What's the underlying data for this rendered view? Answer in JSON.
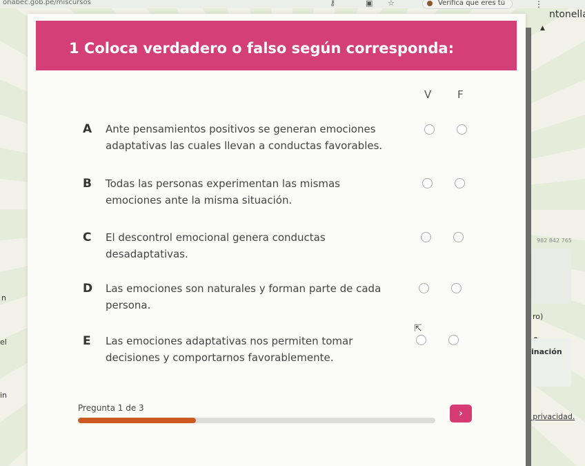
{
  "browser": {
    "url": "onabec.gob.pe/miscursos",
    "verify_chip": "Verifica que eres tú",
    "kebab": "⋮"
  },
  "side_fragments": {
    "right_top": "ntonella,",
    "right_phone": "982 842 765",
    "right_ro": "ro)",
    "right_o": "o",
    "right_inacion": "inación",
    "right_privacy": "e privacidad.",
    "left_n": "n",
    "left_el": "el",
    "left_in": "in"
  },
  "quiz": {
    "title": "1  Coloca verdadero o falso según corresponda:",
    "col_v": "V",
    "col_f": "F",
    "items": [
      {
        "letter": "A",
        "text": "Ante pensamientos positivos se generan emociones adaptativas las cuales llevan a conductas favorables."
      },
      {
        "letter": "B",
        "text": "Todas las personas experimentan las mismas emociones ante la misma situación."
      },
      {
        "letter": "C",
        "text": "El descontrol emocional genera conductas desadaptativas."
      },
      {
        "letter": "D",
        "text": "Las emociones son naturales y forman parte de cada persona."
      },
      {
        "letter": "E",
        "text": "Las emociones adaptativas nos permiten tomar decisiones y comportarnos favorablemente."
      }
    ],
    "progress_label": "Pregunta 1 de 3",
    "progress_fraction": 0.33,
    "next_label": "›"
  },
  "colors": {
    "header": "#d43f78",
    "progress_fill": "#cb5a22",
    "next_button": "#d63b73"
  }
}
